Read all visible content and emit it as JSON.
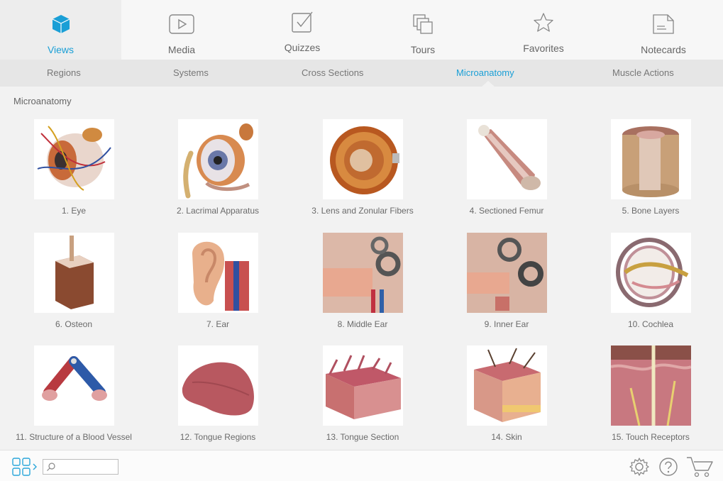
{
  "top_tabs": [
    {
      "label": "Views",
      "icon": "cube-icon",
      "active": true
    },
    {
      "label": "Media",
      "icon": "play-icon"
    },
    {
      "label": "Quizzes",
      "icon": "checkbox-icon"
    },
    {
      "label": "Tours",
      "icon": "stack-icon"
    },
    {
      "label": "Favorites",
      "icon": "star-icon"
    },
    {
      "label": "Notecards",
      "icon": "notecard-icon"
    }
  ],
  "sub_tabs": [
    "Regions",
    "Systems",
    "Cross Sections",
    "Microanatomy",
    "Muscle Actions"
  ],
  "active_sub_tab": "Microanatomy",
  "section_title": "Microanatomy",
  "items": [
    "1. Eye",
    "2. Lacrimal Apparatus",
    "3. Lens and Zonular Fibers",
    "4. Sectioned Femur",
    "5. Bone Layers",
    "6. Osteon",
    "7. Ear",
    "8. Middle Ear",
    "9. Inner Ear",
    "10. Cochlea",
    "11. Structure of a Blood Vessel",
    "12. Tongue Regions",
    "13. Tongue Section",
    "14. Skin",
    "15. Touch Receptors"
  ],
  "search": {
    "placeholder": "",
    "value": ""
  },
  "colors": {
    "accent": "#1a9fd6",
    "topbar": "#f7f7f7",
    "subbar": "#e6e6e6",
    "background": "#f2f2f2"
  }
}
